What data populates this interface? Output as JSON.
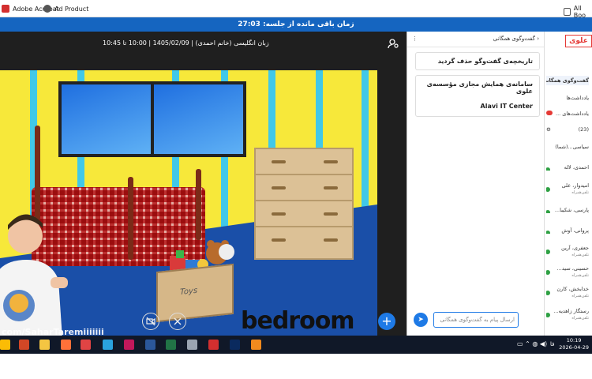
{
  "bookmarks": {
    "items": [
      {
        "label": "Adobe Acrobat",
        "icon": "acrobat-icon",
        "color": "#d32f2f"
      },
      {
        "label": "Ad Product",
        "icon": "globe-icon",
        "color": "#555555"
      }
    ],
    "all_label": "All Boo"
  },
  "session": {
    "timer_text": "زمان باقی مانده از جلسه: 27:03"
  },
  "video": {
    "info": "زبان انگلیسی (خانم احمدی) | 1405/02/09 | 10:00 تا 10:45",
    "scene_word": "bedroom",
    "box_label": "Toys",
    "watermark": "com/SaharTaremiiiiiii"
  },
  "chat": {
    "title": "گفت‌وگوی همگانی",
    "cards": [
      {
        "text": "تاریخچه‌ی گفت‌وگو حذف گردید"
      },
      {
        "text": "سامانه‌ی همایش مجازی مؤسسه‌ی علوی",
        "sub": "Alavi IT Center"
      }
    ],
    "input_placeholder": "ارسال پیام به گفت‌وگوی همگانی"
  },
  "side": {
    "logo": "علوی",
    "tabs": [
      "گفت‌وگوی همگانی",
      "یادداشت‌ها",
      "یادداشت‌های ..."
    ],
    "participants_count": "(23)",
    "participants": [
      {
        "name": "سیاسی...(شما)",
        "sub": ""
      },
      {
        "name": "احمدی، لاله",
        "sub": ""
      },
      {
        "name": "امیدوار، علی",
        "sub": "تلفن‌همراه"
      },
      {
        "name": "پارسی، شکیبا...",
        "sub": ""
      },
      {
        "name": "پروانی، آوش",
        "sub": ""
      },
      {
        "name": "جعفری، آرین",
        "sub": "تلفن‌همراه"
      },
      {
        "name": "حسینی، سید...",
        "sub": "تلفن‌همراه"
      },
      {
        "name": "خدابخش، کارن",
        "sub": "تلفن‌همراه"
      },
      {
        "name": "رستگار زاهدیه...",
        "sub": "تلفن‌همراه"
      }
    ]
  },
  "taskbar": {
    "lang": "فا",
    "time": "10:19",
    "date": "2026-04-29",
    "apps": [
      {
        "name": "chrome-icon",
        "color": "#fbbc05"
      },
      {
        "name": "powerpoint-icon",
        "color": "#d24726"
      },
      {
        "name": "file-explorer-icon",
        "color": "#f4c542"
      },
      {
        "name": "firefox-icon",
        "color": "#ff7139"
      },
      {
        "name": "recorder-icon",
        "color": "#e04444"
      },
      {
        "name": "telegram-icon",
        "color": "#2aa3df"
      },
      {
        "name": "publisher-icon",
        "color": "#c2185b"
      },
      {
        "name": "word-icon",
        "color": "#2b579a"
      },
      {
        "name": "excel-icon",
        "color": "#217346"
      },
      {
        "name": "network-icon",
        "color": "#9aa4b2"
      },
      {
        "name": "pdf-icon",
        "color": "#d32f2f"
      },
      {
        "name": "photoshop-icon",
        "color": "#0a2a5e"
      },
      {
        "name": "vlc-icon",
        "color": "#f28a1e"
      }
    ]
  }
}
